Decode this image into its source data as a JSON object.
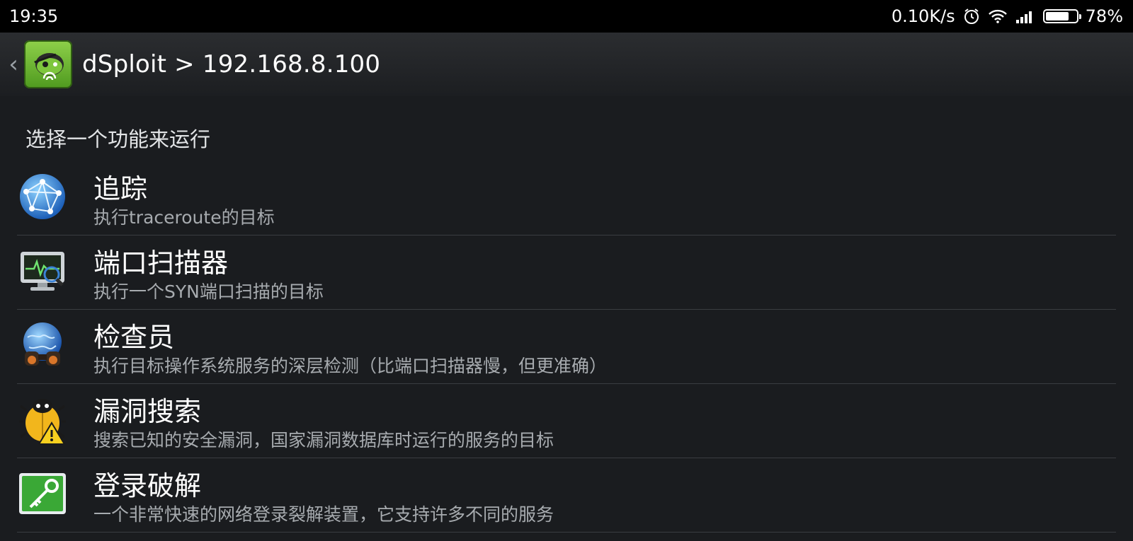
{
  "status_bar": {
    "time": "19:35",
    "net_speed": "0.10K/s",
    "battery_percent_text": "78%",
    "battery_level": 0.78,
    "icons": [
      "alarm-icon",
      "wifi-icon",
      "signal-icon",
      "battery-icon"
    ]
  },
  "action_bar": {
    "back_icon": "chevron-left-icon",
    "title": "dSploit > 192.168.8.100"
  },
  "main": {
    "section_header": "选择一个功能来运行",
    "items": [
      {
        "title": "追踪",
        "desc": "执行traceroute的目标",
        "icon": "network-globe-icon"
      },
      {
        "title": "端口扫描器",
        "desc": "执行一个SYN端口扫描的目标",
        "icon": "monitor-scan-icon"
      },
      {
        "title": "检查员",
        "desc": "执行目标操作系统服务的深层检测（比端口扫描器慢，但更准确）",
        "icon": "globe-binoculars-icon"
      },
      {
        "title": "漏洞搜索",
        "desc": "搜索已知的安全漏洞，国家漏洞数据库时运行的服务的目标",
        "icon": "bug-warning-icon"
      },
      {
        "title": "登录破解",
        "desc": "一个非常快速的网络登录裂解装置，它支持许多不同的服务",
        "icon": "key-icon"
      }
    ]
  },
  "colors": {
    "status_bar_bg": "#000000",
    "background": "#1a1c1f",
    "divider": "#3a3d41",
    "secondary_text": "#a7abaf"
  }
}
